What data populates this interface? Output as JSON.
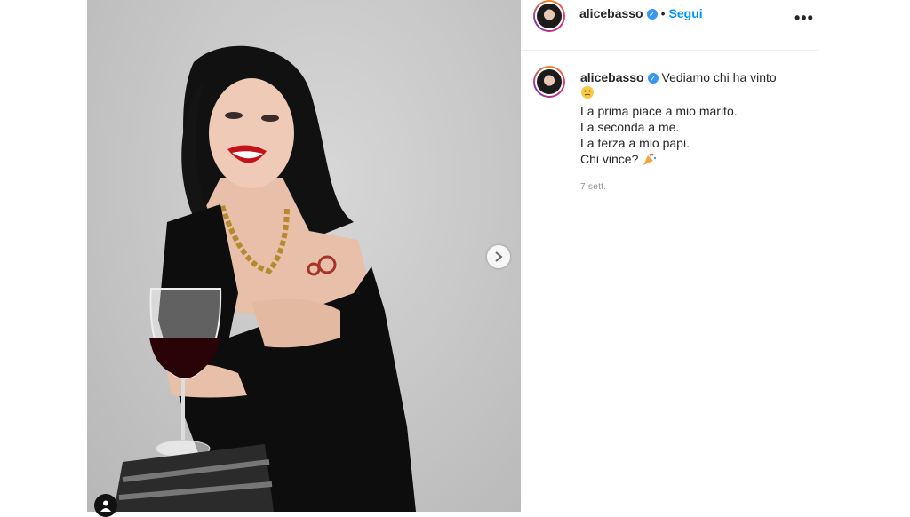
{
  "post": {
    "username": "alicebasso",
    "verified_icon": "verified-badge-icon",
    "follow_label": "Segui",
    "separator": "•",
    "more_label": "•••",
    "caption_first": "Vediamo chi ha vinto",
    "caption_lines": [
      "La prima piace a mio marito.",
      "La seconda a me.",
      "La terza a mio papi.",
      "Chi vince?"
    ],
    "emojis": [
      "thinking-face-emoji",
      "party-popper-emoji"
    ],
    "timestamp": "7 sett."
  },
  "colors": {
    "link_blue": "#0095f6",
    "verified_blue": "#3897f0",
    "text": "#262626",
    "muted": "#8e8e8e",
    "border": "#efefef"
  }
}
